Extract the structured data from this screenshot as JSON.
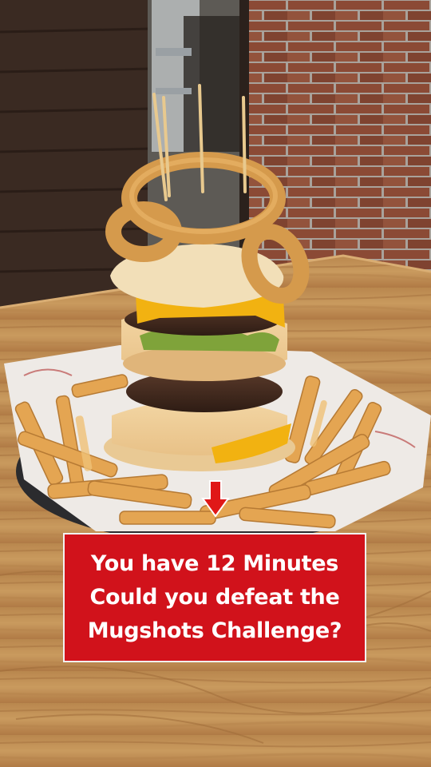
{
  "caption": {
    "lines": [
      "You have 12 Minutes",
      "Could you defeat the",
      "Mugshots Challenge?"
    ],
    "background_color": "#d1121b",
    "text_color": "#ffffff"
  },
  "arrow": {
    "icon": "down-arrow-icon",
    "color": "#e01818"
  },
  "scene": {
    "description_icon": "burger-challenge-photo",
    "colors": {
      "table": "#c79659",
      "brick": "#8a4a34",
      "fries": "#e0a050",
      "cheese": "#f2b211"
    }
  }
}
